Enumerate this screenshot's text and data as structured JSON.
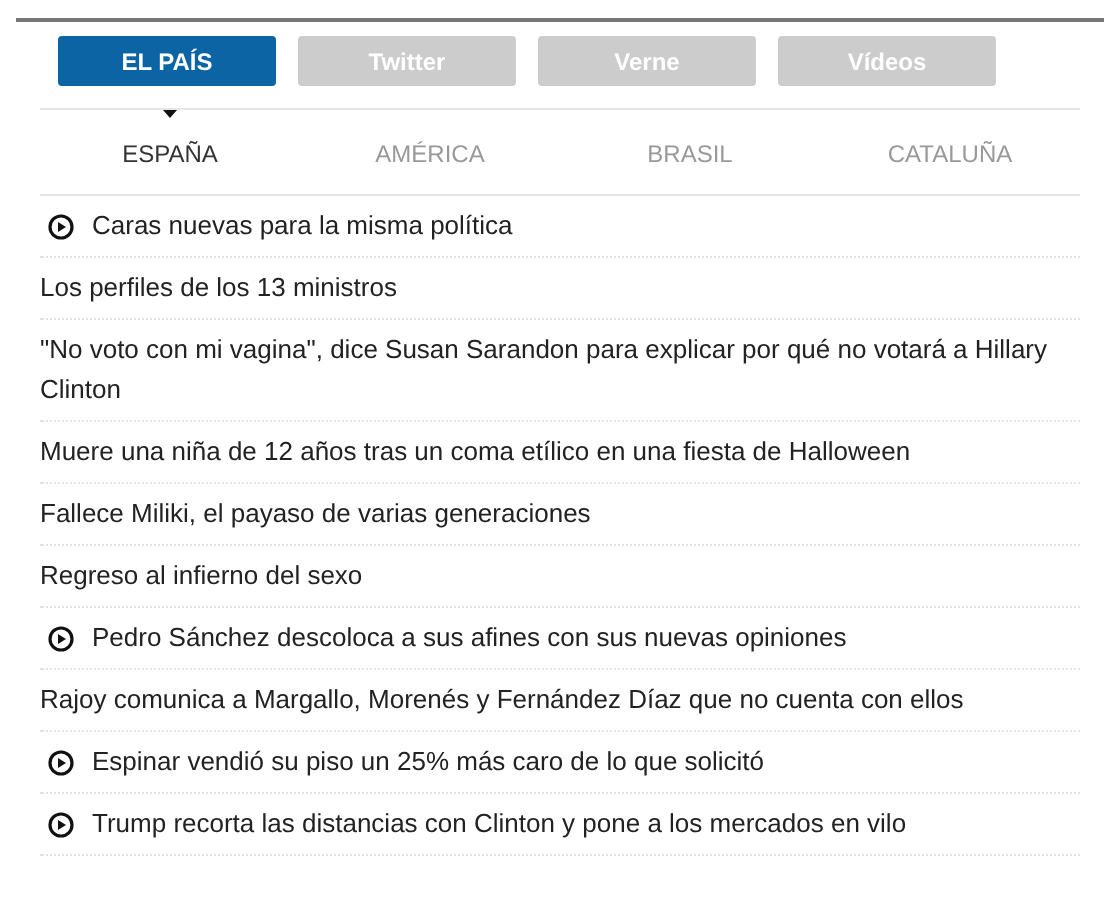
{
  "tabs": [
    {
      "label": "EL PAÍS",
      "selected": true
    },
    {
      "label": "Twitter",
      "selected": false
    },
    {
      "label": "Verne",
      "selected": false
    },
    {
      "label": "Vídeos",
      "selected": false
    }
  ],
  "sections": [
    {
      "label": "ESPAÑA",
      "selected": true
    },
    {
      "label": "AMÉRICA",
      "selected": false
    },
    {
      "label": "BRASIL",
      "selected": false
    },
    {
      "label": "CATALUÑA",
      "selected": false
    }
  ],
  "headlines": [
    {
      "kind": "video",
      "text": "Caras nuevas para la misma política"
    },
    {
      "kind": "text",
      "text": "Los perfiles de los 13 ministros"
    },
    {
      "kind": "text",
      "text": "\"No voto con mi vagina\", dice Susan Sarandon para explicar por qué no votará a Hillary Clinton"
    },
    {
      "kind": "text",
      "text": "Muere una niña de 12 años tras un coma etílico en una fiesta de Halloween"
    },
    {
      "kind": "text",
      "text": "Fallece Miliki, el payaso de varias generaciones"
    },
    {
      "kind": "text",
      "text": "Regreso al infierno del sexo"
    },
    {
      "kind": "video",
      "text": "Pedro Sánchez descoloca a sus afines con sus nuevas opiniones"
    },
    {
      "kind": "text",
      "text": "Rajoy comunica a Margallo, Morenés y Fernández Díaz que no cuenta con ellos"
    },
    {
      "kind": "video",
      "text": "Espinar vendió su piso un 25% más caro de lo que solicitó"
    },
    {
      "kind": "video",
      "text": "Trump recorta las distancias con Clinton y pone a los mercados en vilo"
    }
  ]
}
